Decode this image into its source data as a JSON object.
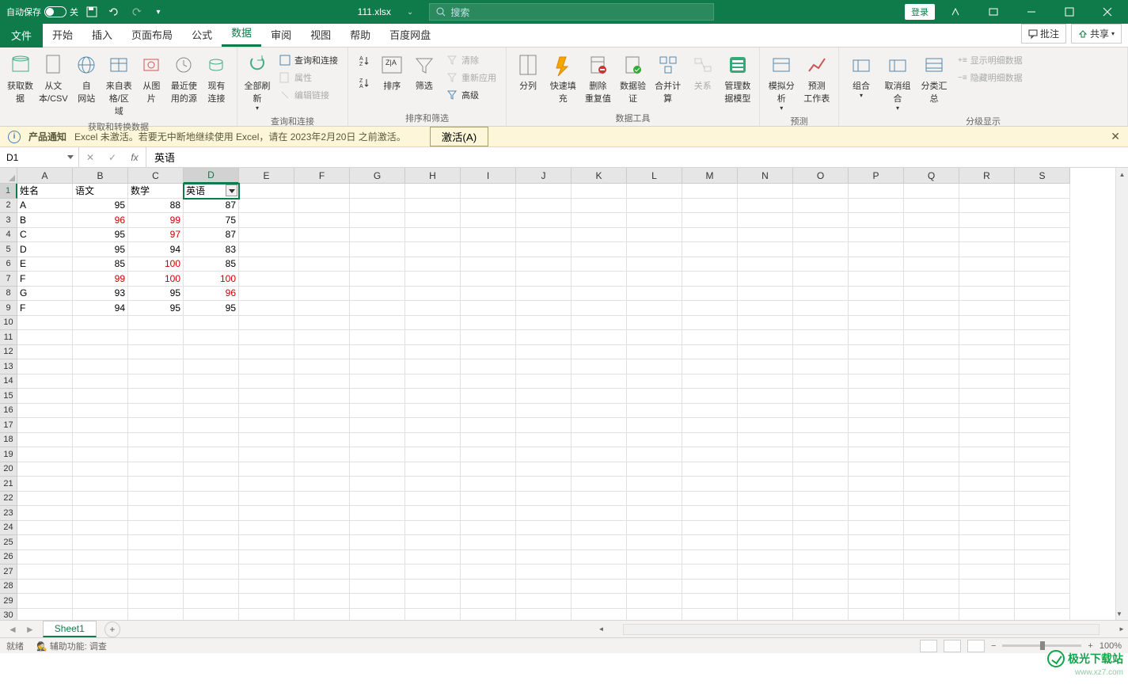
{
  "titlebar": {
    "autosave_label": "自动保存",
    "autosave_state": "关",
    "filename": "111.xlsx",
    "search_placeholder": "搜索",
    "login_label": "登录"
  },
  "tabs": {
    "file": "文件",
    "items": [
      "开始",
      "插入",
      "页面布局",
      "公式",
      "数据",
      "审阅",
      "视图",
      "帮助",
      "百度网盘"
    ],
    "active_index": 4,
    "comments": "批注",
    "share": "共享"
  },
  "ribbon": {
    "groups": [
      {
        "label": "获取和转换数据",
        "items": [
          "获取数",
          "从文",
          "自",
          "来自表",
          "从图",
          "最近使",
          "现有"
        ],
        "subs": [
          "据",
          "本/CSV",
          "网站",
          "格/区域",
          "片",
          "用的源",
          "连接"
        ]
      },
      {
        "label": "查询和连接",
        "big": "全部刷新",
        "smalls": [
          "查询和连接",
          "属性",
          "编辑链接"
        ]
      },
      {
        "label": "排序和筛选",
        "bigs": [
          "排序",
          "筛选"
        ],
        "smalls": [
          "清除",
          "重新应用",
          "高级"
        ]
      },
      {
        "label": "数据工具",
        "items": [
          "分列",
          "快速填充",
          "删除",
          "数据验",
          "合并计算",
          "关系",
          "管理数"
        ],
        "subs": [
          "",
          "",
          "重复值",
          "证",
          "",
          "",
          "据模型"
        ]
      },
      {
        "label": "预测",
        "items": [
          "模拟分析",
          "预测"
        ],
        "subs": [
          "",
          "工作表"
        ]
      },
      {
        "label": "分级显示",
        "items": [
          "组合",
          "取消组合",
          "分类汇总"
        ],
        "smalls": [
          "显示明细数据",
          "隐藏明细数据"
        ]
      }
    ]
  },
  "notification": {
    "title": "产品通知",
    "text": "Excel 未激活。若要无中断地继续使用 Excel，请在 2023年2月20日 之前激活。",
    "button": "激活(A)"
  },
  "formulabar": {
    "cellref": "D1",
    "content": "英语"
  },
  "columns": [
    "A",
    "B",
    "C",
    "D",
    "E",
    "F",
    "G",
    "H",
    "I",
    "J",
    "K",
    "L",
    "M",
    "N",
    "O",
    "P",
    "Q",
    "R",
    "S"
  ],
  "active_col_index": 3,
  "rows": 30,
  "active_row": 1,
  "data_rows": [
    {
      "a": "姓名",
      "b": "语文",
      "c": "数学",
      "d": "英语",
      "header": true
    },
    {
      "a": "A",
      "b": 95,
      "c": 88,
      "d": 87
    },
    {
      "a": "B",
      "b": 96,
      "c": 99,
      "d": 75,
      "red_b": true,
      "red_c": true
    },
    {
      "a": "C",
      "b": 95,
      "c": 97,
      "d": 87,
      "red_c": true
    },
    {
      "a": "D",
      "b": 95,
      "c": 94,
      "d": 83
    },
    {
      "a": "E",
      "b": 85,
      "c": 100,
      "d": 85,
      "red_c": true
    },
    {
      "a": "F",
      "b": 99,
      "c": 100,
      "d": 100,
      "red_b": true,
      "red_c": true,
      "red_d": true
    },
    {
      "a": "G",
      "b": 93,
      "c": 95,
      "d": 96,
      "red_d": true
    },
    {
      "a": "F",
      "b": 94,
      "c": 95,
      "d": 95
    }
  ],
  "sheet": {
    "name": "Sheet1"
  },
  "status": {
    "ready": "就绪",
    "access": "辅助功能: 调查",
    "zoom": "100%"
  },
  "watermark": {
    "text": "极光下载站",
    "url": "www.xz7.com"
  }
}
